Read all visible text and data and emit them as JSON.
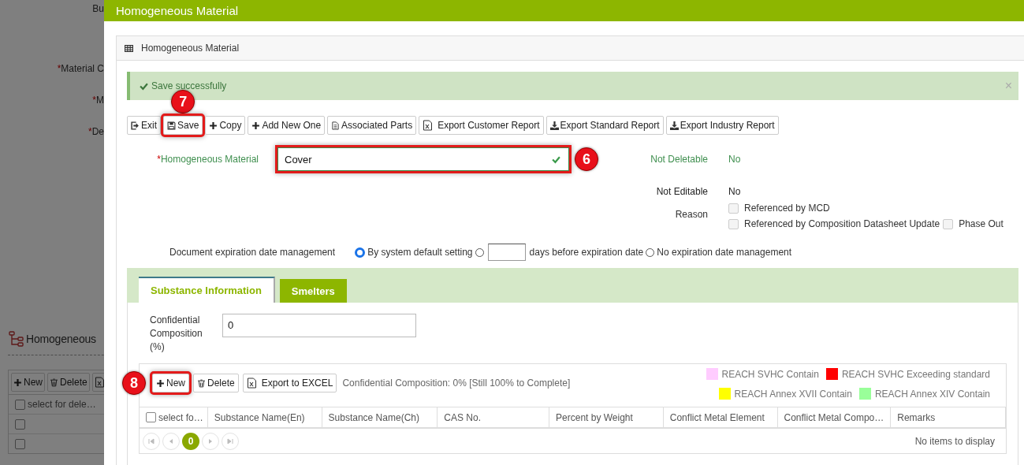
{
  "background": {
    "fields": [
      {
        "label": "Bu"
      },
      {
        "mark": "*",
        "label": "Material C"
      },
      {
        "mark": "*",
        "label": "M"
      },
      {
        "mark": "*",
        "label": "De"
      }
    ],
    "section_title": "Homogeneous",
    "buttons": [
      {
        "kind": "plus",
        "label": "New"
      },
      {
        "kind": "trash",
        "label": "Delete"
      },
      {
        "kind": "excel"
      }
    ],
    "table": {
      "columns": [
        {
          "label": "select for dele…",
          "checked": false
        }
      ],
      "rows": [
        {
          "checked": false
        },
        {
          "checked": false
        }
      ]
    }
  },
  "dialog": {
    "title": "Homogeneous Material",
    "panel_title": "Homogeneous Material",
    "alert": {
      "message": "Save successfully",
      "close": "×"
    },
    "toolbar": [
      {
        "kind": "exit",
        "label": "Exit",
        "highlighted": false
      },
      {
        "kind": "save",
        "label": "Save",
        "highlighted": true,
        "callout": "7"
      },
      {
        "kind": "plus",
        "label": "Copy",
        "highlighted": false
      },
      {
        "kind": "plus",
        "label": "Add New One",
        "highlighted": false
      },
      {
        "kind": "doc",
        "label": "Associated Parts",
        "highlighted": false
      },
      {
        "kind": "excel",
        "label": "Export Customer Report",
        "highlighted": false
      },
      {
        "kind": "download",
        "label": "Export Standard Report",
        "highlighted": false
      },
      {
        "kind": "download",
        "label": "Export Industry Report",
        "highlighted": false
      }
    ],
    "field": {
      "mark": "*",
      "label": "Homogeneous Material",
      "value": "Cover",
      "valid": true,
      "highlighted": true,
      "callout": "6"
    },
    "status": [
      {
        "label": "Not Deletable",
        "value": "No",
        "color": "#3f8f4f"
      },
      {
        "label": "Not Editable",
        "value": "No",
        "color": "#222222"
      }
    ],
    "reason": {
      "label": "Reason",
      "options": [
        {
          "label": "Referenced by MCD",
          "checked": false
        },
        {
          "label": "Referenced by Composition Datasheet Update",
          "checked": false
        },
        {
          "label": "Phase Out",
          "checked": false
        }
      ]
    },
    "expiration": {
      "label": "Document expiration date management",
      "options": [
        {
          "kind": "radio",
          "label": "By system default setting",
          "selected": true
        },
        {
          "kind": "days",
          "label": "days before expiration date",
          "selected": false
        },
        {
          "kind": "radio",
          "label": "No expiration date management",
          "selected": false
        }
      ]
    },
    "tabs": [
      {
        "label": "Substance Information",
        "selected": true
      },
      {
        "label": "Smelters",
        "selected": false
      }
    ],
    "confidential": {
      "label": "Confidential Composition (%)",
      "value": "0"
    },
    "grid_toolbar": [
      {
        "kind": "plus",
        "label": "New",
        "highlighted": true,
        "callout": "8"
      },
      {
        "kind": "trash",
        "label": "Delete",
        "highlighted": false
      },
      {
        "kind": "excel",
        "label": "Export to EXCEL",
        "highlighted": false
      }
    ],
    "summary": "Confidential Composition: 0% [Still 100% to Complete]",
    "legend": [
      {
        "label": "REACH SVHC Contain",
        "color": "#ffccff"
      },
      {
        "label": "REACH SVHC Exceeding standard",
        "color": "#ff0000"
      },
      {
        "label": "REACH Annex XVII Contain",
        "color": "#ffff00"
      },
      {
        "label": "REACH Annex XIV Contain",
        "color": "#99ff99"
      }
    ],
    "table": {
      "columns": [
        {
          "label": "select fo…",
          "kind": "checkbox",
          "checked": false
        },
        {
          "label": "Substance Name(En)",
          "kind": "text"
        },
        {
          "label": "Substance Name(Ch)",
          "kind": "text"
        },
        {
          "label": "CAS No.",
          "kind": "text"
        },
        {
          "label": "Percent by Weight",
          "kind": "text"
        },
        {
          "label": "Conflict Metal Element",
          "kind": "text"
        },
        {
          "label": "Conflict Metal Compo…",
          "kind": "text"
        },
        {
          "label": "Remarks",
          "kind": "text"
        }
      ],
      "empty_message": "No items to display"
    },
    "pager": {
      "page": "0"
    }
  }
}
